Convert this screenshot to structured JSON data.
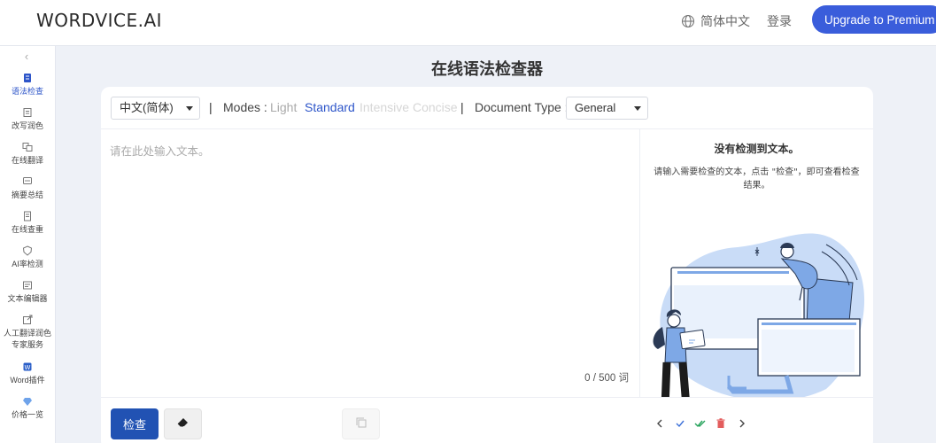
{
  "header": {
    "logo": "WORDVICE.AI",
    "language": "简体中文",
    "login": "登录",
    "upgrade": "Upgrade to Premium",
    "upgrade_color": "#3a5ddb"
  },
  "sidebar": {
    "items": [
      {
        "label": "语法检查",
        "icon": "grammar-icon",
        "active": true
      },
      {
        "label": "改写润色",
        "icon": "rewrite-icon"
      },
      {
        "label": "在线翻译",
        "icon": "translate-icon"
      },
      {
        "label": "摘要总结",
        "icon": "summary-icon"
      },
      {
        "label": "在线查重",
        "icon": "plagiarism-icon"
      },
      {
        "label": "AI率检测",
        "icon": "ai-detect-icon"
      },
      {
        "label": "文本编辑器",
        "icon": "editor-icon"
      },
      {
        "label": "人工翻译润色",
        "label2": "专家服务",
        "icon": "expert-service-icon"
      },
      {
        "label": "Word插件",
        "icon": "word-icon"
      },
      {
        "label": "价格一览",
        "icon": "diamond-icon"
      }
    ]
  },
  "main": {
    "title": "在线语法检查器",
    "language_select": "中文(简体)",
    "separator": "|",
    "modes_label": "Modes :",
    "modes": [
      {
        "label": "Light",
        "state": "inactive"
      },
      {
        "label": "Standard",
        "state": "selected"
      },
      {
        "label": "Intensive",
        "state": "disabled"
      },
      {
        "label": "Concise",
        "state": "disabled"
      }
    ],
    "doc_type_label": "Document Type :",
    "doc_type_value": "General",
    "editor_placeholder": "请在此处输入文本。",
    "editor_value": "",
    "word_count": "0 / 500 词",
    "result_title": "没有检测到文本。",
    "result_text": "请输入需要检查的文本，点击 \"检查\"，即可查看检查结果。",
    "check_button": "检查",
    "accent": "#2152b3"
  }
}
